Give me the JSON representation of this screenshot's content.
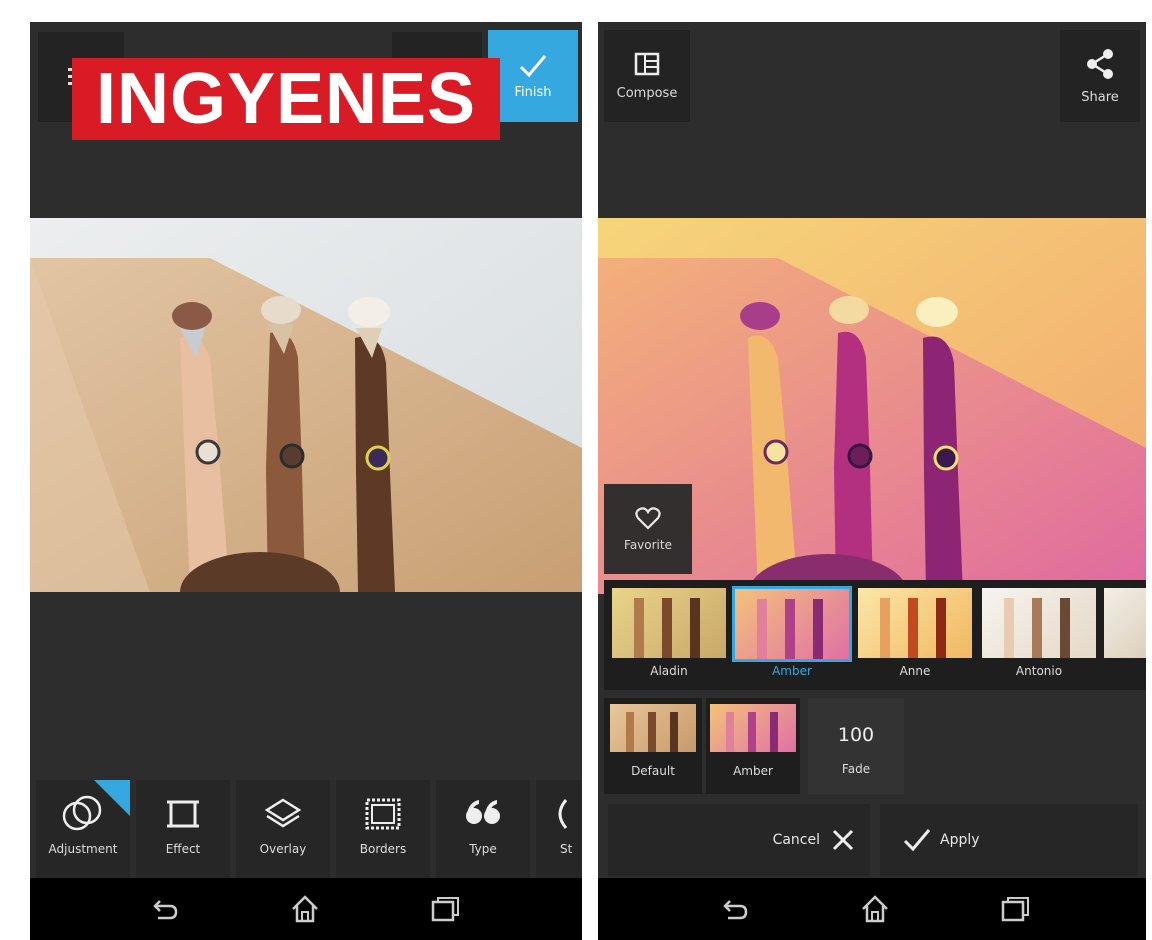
{
  "banner": {
    "text": "INGYENES"
  },
  "left": {
    "top_right_label": "Finish",
    "tools": [
      {
        "label": "Adjustment",
        "icon": "adjustment-icon"
      },
      {
        "label": "Effect",
        "icon": "effect-crop-icon"
      },
      {
        "label": "Overlay",
        "icon": "layers-icon"
      },
      {
        "label": "Borders",
        "icon": "border-frame-icon"
      },
      {
        "label": "Type",
        "icon": "quote-icon"
      },
      {
        "label": "St",
        "icon": "sticker-icon"
      }
    ]
  },
  "right": {
    "compose_label": "Compose",
    "share_label": "Share",
    "favorite_label": "Favorite",
    "filters": [
      {
        "name": "Aladin",
        "selected": false
      },
      {
        "name": "Amber",
        "selected": true
      },
      {
        "name": "Anne",
        "selected": false
      },
      {
        "name": "Antonio",
        "selected": false
      }
    ],
    "compare": {
      "default_label": "Default",
      "current_label": "Amber"
    },
    "fade": {
      "value": "100",
      "label": "Fade"
    },
    "cancel_label": "Cancel",
    "apply_label": "Apply"
  },
  "colors": {
    "accent": "#35a9df",
    "banner_red": "#d91b26",
    "panel": "#2d2d2d"
  }
}
